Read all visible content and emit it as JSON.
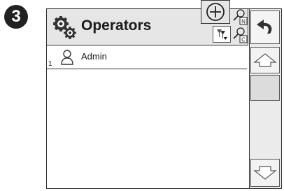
{
  "step": {
    "number": "3"
  },
  "header": {
    "title": "Operators",
    "search_n_label": "N",
    "search_c_label": "C"
  },
  "operators": [
    {
      "index": "1",
      "name": "Admin"
    }
  ],
  "colors": {
    "header_bg": "#e6e6e6",
    "sidebar_bg": "#ebebeb",
    "border": "#333333"
  },
  "icons": {
    "header": "gears-icon",
    "add": "add-circle-icon",
    "search_n": "search-name-icon",
    "search_c": "search-code-icon",
    "filter": "filter-icon",
    "operator": "person-icon",
    "back": "back-arrow-icon",
    "scroll_up": "arrow-up-icon",
    "scroll_down": "arrow-down-icon"
  }
}
